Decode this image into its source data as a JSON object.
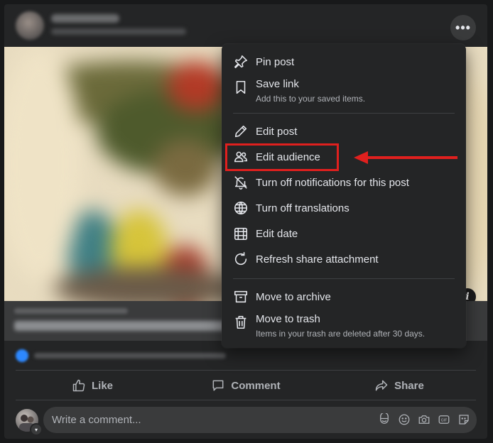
{
  "post": {
    "more_options_label": "•••"
  },
  "link_preview": {
    "info_label": "i"
  },
  "actions": {
    "like": "Like",
    "comment": "Comment",
    "share": "Share"
  },
  "comment_input": {
    "placeholder": "Write a comment..."
  },
  "menu": {
    "items": [
      {
        "label": "Pin post",
        "icon": "pin-icon"
      },
      {
        "label": "Save link",
        "subtitle": "Add this to your saved items.",
        "icon": "bookmark-icon"
      },
      {
        "label": "Edit post",
        "icon": "pencil-icon"
      },
      {
        "label": "Edit audience",
        "icon": "people-icon"
      },
      {
        "label": "Turn off notifications for this post",
        "icon": "bell-off-icon"
      },
      {
        "label": "Turn off translations",
        "icon": "globe-icon"
      },
      {
        "label": "Edit date",
        "icon": "calendar-icon"
      },
      {
        "label": "Refresh share attachment",
        "icon": "refresh-icon"
      },
      {
        "label": "Move to archive",
        "icon": "archive-icon"
      },
      {
        "label": "Move to trash",
        "subtitle": "Items in your trash are deleted after 30 days.",
        "icon": "trash-icon"
      }
    ]
  },
  "colors": {
    "background": "#18191a",
    "card": "#242526",
    "surface": "#3a3b3c",
    "text_primary": "#e4e6eb",
    "text_secondary": "#b0b3b8",
    "annotation_red": "#e0201e"
  }
}
